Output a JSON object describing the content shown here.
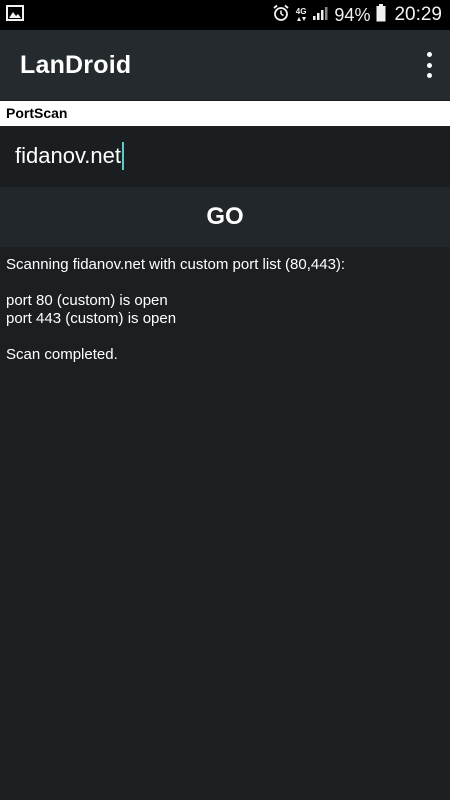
{
  "status_bar": {
    "left_icon": "image-notification-icon",
    "network": "4G",
    "battery_percent": "94%",
    "time": "20:29"
  },
  "app_bar": {
    "title": "LanDroid",
    "menu_icon": "overflow-menu-icon"
  },
  "section": {
    "title": "PortScan"
  },
  "host_input": {
    "value": "fidanov.net"
  },
  "go_button": {
    "label": "GO"
  },
  "output": {
    "header": "Scanning fidanov.net with custom port list (80,443):",
    "results": [
      "port 80 (custom) is open",
      "port 443 (custom) is open"
    ],
    "footer": "Scan completed."
  },
  "colors": {
    "background": "#1b1f22",
    "app_bar": "#242a2d",
    "cursor_accent": "#5fc9c3"
  }
}
